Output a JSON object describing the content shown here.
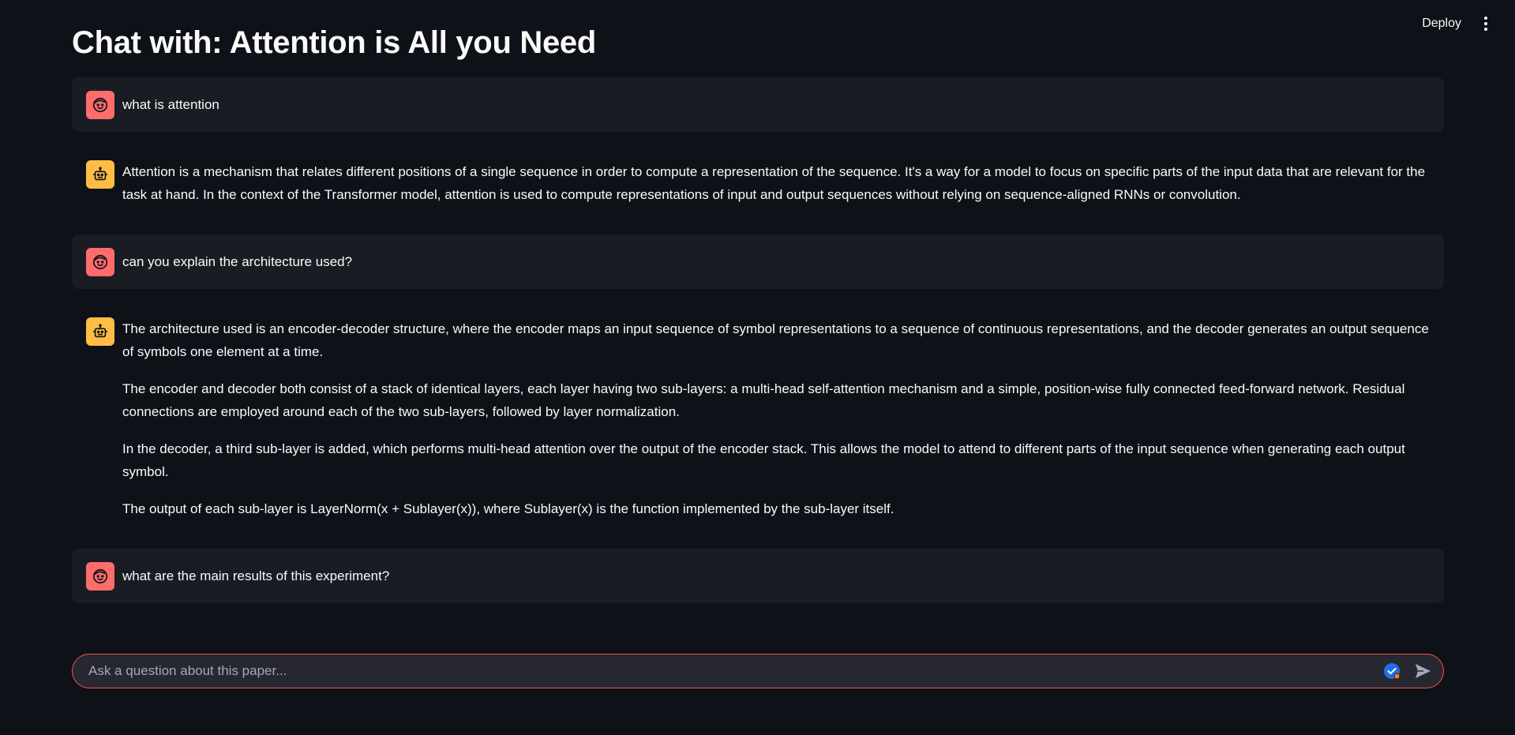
{
  "toolbar": {
    "deploy_label": "Deploy",
    "menu_icon": "kebab-menu-icon"
  },
  "page": {
    "title": "Chat with: Attention is All you Need"
  },
  "messages": [
    {
      "role": "user",
      "avatar_icon": "user-face-icon",
      "text": "what is attention"
    },
    {
      "role": "assistant",
      "avatar_icon": "robot-icon",
      "paragraphs": [
        "Attention is a mechanism that relates different positions of a single sequence in order to compute a representation of the sequence. It's a way for a model to focus on specific parts of the input data that are relevant for the task at hand. In the context of the Transformer model, attention is used to compute representations of input and output sequences without relying on sequence-aligned RNNs or convolution."
      ]
    },
    {
      "role": "user",
      "avatar_icon": "user-face-icon",
      "text": "can you explain the architecture used?"
    },
    {
      "role": "assistant",
      "avatar_icon": "robot-icon",
      "paragraphs": [
        "The architecture used is an encoder-decoder structure, where the encoder maps an input sequence of symbol representations to a sequence of continuous representations, and the decoder generates an output sequence of symbols one element at a time.",
        "The encoder and decoder both consist of a stack of identical layers, each layer having two sub-layers: a multi-head self-attention mechanism and a simple, position-wise fully connected feed-forward network. Residual connections are employed around each of the two sub-layers, followed by layer normalization.",
        "In the decoder, a third sub-layer is added, which performs multi-head attention over the output of the encoder stack. This allows the model to attend to different parts of the input sequence when generating each output symbol.",
        "The output of each sub-layer is LayerNorm(x + Sublayer(x)), where Sublayer(x) is the function implemented by the sub-layer itself."
      ]
    },
    {
      "role": "user",
      "avatar_icon": "user-face-icon",
      "text": "what are the main results of this experiment?"
    }
  ],
  "chat_input": {
    "placeholder": "Ask a question about this paper...",
    "value": "",
    "grammar_icon": "grammar-check-icon",
    "send_icon": "send-icon"
  },
  "colors": {
    "background": "#0e1117",
    "user_bubble": "#1a1c24",
    "user_avatar": "#ff6c6c",
    "assistant_avatar": "#ffbd45",
    "input_border": "#ff4b4b"
  }
}
